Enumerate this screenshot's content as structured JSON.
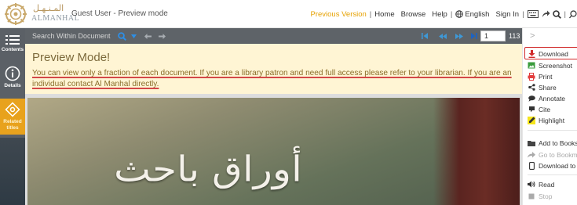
{
  "header": {
    "logo_arabic": "المـنـهـل",
    "logo_english": "ALMANHAL",
    "guest_label": "Guest User - Preview mode",
    "nav": {
      "previous_version": "Previous Version",
      "home": "Home",
      "browse": "Browse",
      "help": "Help",
      "language": "English",
      "sign_in": "Sign In"
    },
    "separator": "|"
  },
  "rail": {
    "contents": "Contents",
    "details": "Details",
    "related_1": "Related",
    "related_2": "titles"
  },
  "toolbar": {
    "search_placeholder": "Search Within Document",
    "page_value": "1",
    "page_total": "113"
  },
  "notice": {
    "title": "Preview Mode!",
    "body": "You can view only a fraction of each document. If you are a library patron and need full access please refer to your librarian. If you are an individual contact Al Manhal directly."
  },
  "cover": {
    "title_text": "أوراق باحث"
  },
  "right_panel": {
    "chevron": ">",
    "items": [
      {
        "label": "Download",
        "icon": "download-icon"
      },
      {
        "label": "Screenshot",
        "icon": "image-icon"
      },
      {
        "label": "Print",
        "icon": "print-icon"
      },
      {
        "label": "Share",
        "icon": "share-icon"
      },
      {
        "label": "Annotate",
        "icon": "comment-icon"
      },
      {
        "label": "Cite",
        "icon": "quote-icon"
      },
      {
        "label": "Highlight",
        "icon": "highlighter-icon"
      },
      {
        "label": "Add to Bookshelf",
        "icon": "folder-icon"
      },
      {
        "label": "Go to Bookmark",
        "icon": "arrow-icon"
      },
      {
        "label": "Download to Device",
        "icon": "device-icon"
      },
      {
        "label": "Read",
        "icon": "speaker-icon"
      },
      {
        "label": "Stop",
        "icon": "stop-icon"
      }
    ]
  },
  "colors": {
    "accent_orange": "#e6a100",
    "notice_bg": "#fff5d4",
    "highlight_red": "#d12a2a",
    "toolbar_gray": "#5e6368"
  }
}
